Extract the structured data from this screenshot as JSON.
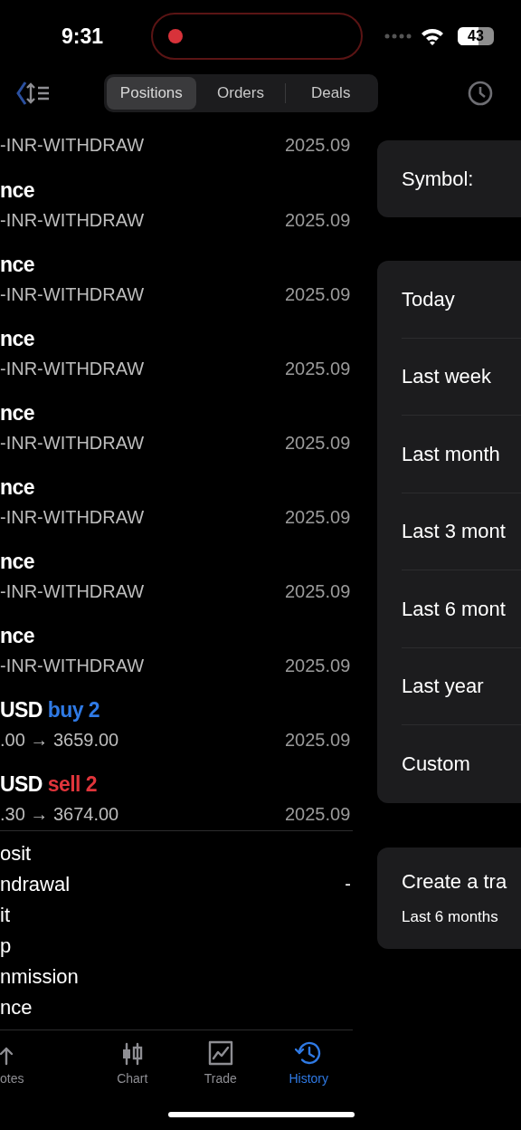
{
  "status_bar": {
    "time": "9:31",
    "recording": true,
    "battery": "43"
  },
  "toolbar": {
    "segments": [
      {
        "label": "Positions",
        "selected": true
      },
      {
        "label": "Orders",
        "selected": false
      },
      {
        "label": "Deals",
        "selected": false
      }
    ]
  },
  "deals": [
    {
      "kind": "balance",
      "subtitle": "-INR-WITHDRAW",
      "date": "2025.09"
    },
    {
      "kind": "balance",
      "title": "nce",
      "subtitle": "-INR-WITHDRAW",
      "date": "2025.09"
    },
    {
      "kind": "balance",
      "title": "nce",
      "subtitle": "-INR-WITHDRAW",
      "date": "2025.09"
    },
    {
      "kind": "balance",
      "title": "nce",
      "subtitle": "-INR-WITHDRAW",
      "date": "2025.09"
    },
    {
      "kind": "balance",
      "title": "nce",
      "subtitle": "-INR-WITHDRAW",
      "date": "2025.09"
    },
    {
      "kind": "balance",
      "title": "nce",
      "subtitle": "-INR-WITHDRAW",
      "date": "2025.09"
    },
    {
      "kind": "balance",
      "title": "nce",
      "subtitle": "-INR-WITHDRAW",
      "date": "2025.09"
    },
    {
      "kind": "balance",
      "title": "nce",
      "subtitle": "-INR-WITHDRAW",
      "date": "2025.09"
    },
    {
      "kind": "buy",
      "title": "USD",
      "side": "buy 2",
      "subtitle": ".00 → 3659.00",
      "date": "2025.09"
    },
    {
      "kind": "sell",
      "title": "USD",
      "side": "sell 2",
      "subtitle": ".30 → 3674.00",
      "date": "2025.09"
    }
  ],
  "summary": [
    {
      "label": "osit"
    },
    {
      "label": "ndrawal",
      "value": "-"
    },
    {
      "label": "it"
    },
    {
      "label": "p"
    },
    {
      "label": "nmission"
    },
    {
      "label": "nce"
    }
  ],
  "tab_bar": [
    {
      "label": "otes",
      "selected": false
    },
    {
      "label": "Chart",
      "selected": false
    },
    {
      "label": "Trade",
      "selected": false
    },
    {
      "label": "History",
      "selected": true
    }
  ],
  "filter": {
    "symbol_label": "Symbol:",
    "periods": [
      "Today",
      "Last week",
      "Last month",
      "Last 3 mont",
      "Last 6 mont",
      "Last year",
      "Custom"
    ],
    "report": {
      "title": "Create a tra",
      "subtitle": "Last 6 months"
    }
  }
}
